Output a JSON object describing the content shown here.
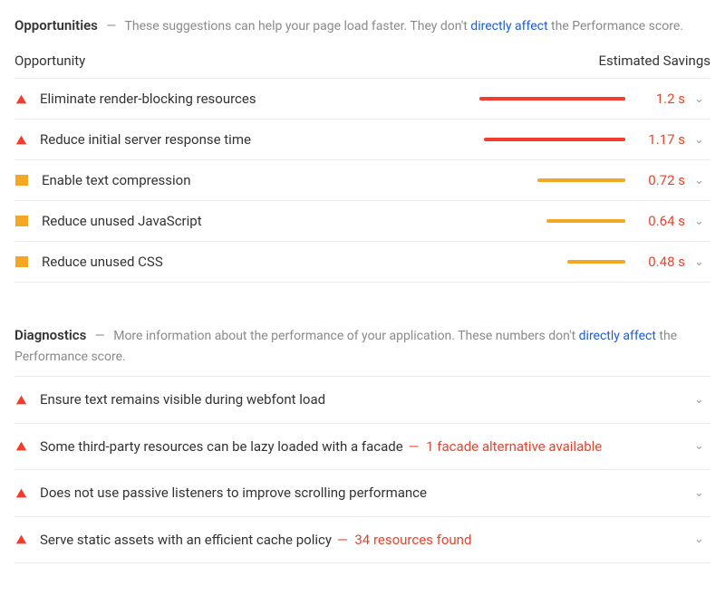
{
  "opportunities": {
    "title": "Opportunities",
    "desc_prefix": "These suggestions can help your page load faster. They don't ",
    "desc_link": "directly affect",
    "desc_suffix": " the Performance score.",
    "col_label": "Opportunity",
    "col_savings": "Estimated Savings",
    "items": [
      {
        "severity": "red",
        "label": "Eliminate render-blocking resources",
        "bar_pct": 70,
        "savings": "1.2 s"
      },
      {
        "severity": "red",
        "label": "Reduce initial server response time",
        "bar_pct": 68,
        "savings": "1.17 s"
      },
      {
        "severity": "orange",
        "label": "Enable text compression",
        "bar_pct": 42,
        "savings": "0.72 s"
      },
      {
        "severity": "orange",
        "label": "Reduce unused JavaScript",
        "bar_pct": 38,
        "savings": "0.64 s"
      },
      {
        "severity": "orange",
        "label": "Reduce unused CSS",
        "bar_pct": 28,
        "savings": "0.48 s"
      }
    ]
  },
  "diagnostics": {
    "title": "Diagnostics",
    "desc_prefix": "More information about the performance of your application. These numbers don't ",
    "desc_link": "directly affect",
    "desc_suffix": " the Performance score.",
    "items": [
      {
        "severity": "red",
        "label": "Ensure text remains visible during webfont load",
        "badge": ""
      },
      {
        "severity": "red",
        "label": "Some third-party resources can be lazy loaded with a facade",
        "badge": "1 facade alternative available"
      },
      {
        "severity": "red",
        "label": "Does not use passive listeners to improve scrolling performance",
        "badge": ""
      },
      {
        "severity": "red",
        "label": "Serve static assets with an efficient cache policy",
        "badge": "34 resources found"
      }
    ]
  }
}
